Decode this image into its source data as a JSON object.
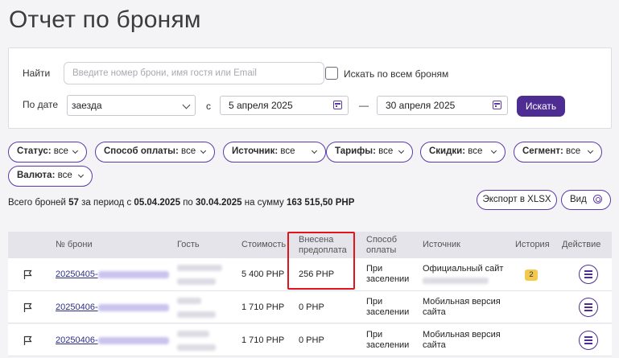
{
  "page": {
    "title": "Отчет по броням"
  },
  "filters": {
    "search_label": "Найти",
    "search_placeholder": "Введите номер брони, имя гостя или Email",
    "search_all_label": "Искать по всем броням",
    "date_label": "По дате",
    "date_type": "заезда",
    "from_label": "с",
    "date_from": "5 апреля 2025",
    "dash": "—",
    "date_to": "30 апреля 2025",
    "search_button": "Искать"
  },
  "chips": [
    {
      "label": "Статус:",
      "value": "все"
    },
    {
      "label": "Способ оплаты:",
      "value": "все"
    },
    {
      "label": "Источник:",
      "value": "все"
    },
    {
      "label": "Тарифы:",
      "value": "все"
    },
    {
      "label": "Скидки:",
      "value": "все"
    },
    {
      "label": "Сегмент:",
      "value": "все"
    },
    {
      "label": "Валюта:",
      "value": "все"
    }
  ],
  "summary": {
    "prefix": "Всего броней",
    "count": "57",
    "period_text": "за период с",
    "from": "05.04.2025",
    "to_text": "по",
    "to": "30.04.2025",
    "sum_text": "на сумму",
    "sum": "163 515,50 PHP"
  },
  "toolbar": {
    "export_label": "Экспорт в XLSX",
    "view_label": "Вид"
  },
  "table": {
    "headers": {
      "booking": "№ брони",
      "guest": "Гость",
      "cost": "Стоимость",
      "prepay_line1": "Внесена",
      "prepay_line2": "предоплата",
      "payment_line1": "Способ",
      "payment_line2": "оплаты",
      "source": "Источник",
      "history": "История",
      "action": "Действие"
    },
    "rows": [
      {
        "booking_prefix": "20250405-",
        "cost": "5 400 PHP",
        "prepay": "256 PHP",
        "payment_line1": "При",
        "payment_line2": "заселении",
        "source_line1": "Официальный сайт",
        "source_line2": "",
        "history": "2"
      },
      {
        "booking_prefix": "20250406-",
        "cost": "1 710 PHP",
        "prepay": "0 PHP",
        "payment_line1": "При",
        "payment_line2": "заселении",
        "source_line1": "Мобильная версия",
        "source_line2": "сайта",
        "history": ""
      },
      {
        "booking_prefix": "20250406-",
        "cost": "1 710 PHP",
        "prepay": "0 PHP",
        "payment_line1": "При",
        "payment_line2": "заселении",
        "source_line1": "Мобильная версия",
        "source_line2": "сайта",
        "history": ""
      }
    ]
  },
  "colors": {
    "accent": "#4e2d92",
    "highlight": "#e0141a",
    "badge": "#f3c84f"
  }
}
